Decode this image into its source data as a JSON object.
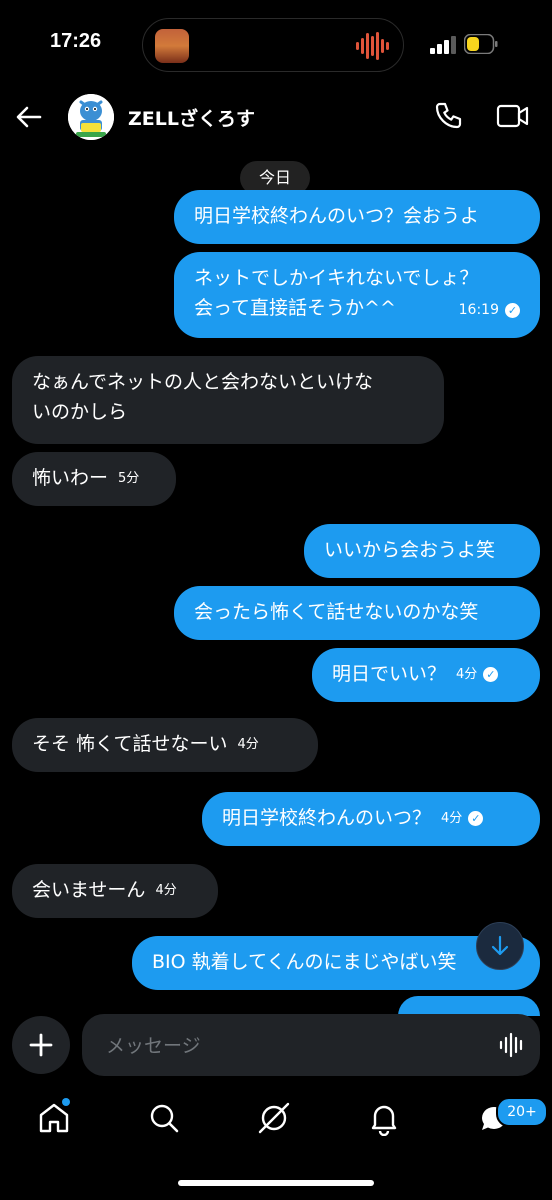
{
  "status": {
    "time": "17:26"
  },
  "header": {
    "contact_name": "ZELLざくろす"
  },
  "date_chip": "今日",
  "messages": [
    {
      "text": "明日学校終わんのいつ？会おうよ"
    },
    {
      "lines": [
        "ネットでしかイキれないでしょ？",
        "会って直接話そうか^^"
      ],
      "time": "16:19"
    },
    {
      "lines": [
        "なぁんでネットの人と会わないといけな",
        "いのかしら"
      ]
    },
    {
      "text": "怖いわー",
      "time": "5分"
    },
    {
      "text": "いいから会おうよ笑"
    },
    {
      "text": "会ったら怖くて話せないのかな笑"
    },
    {
      "text": "明日でいい？",
      "time": "4分"
    },
    {
      "text": "そそ  怖くて話せなーい",
      "time": "4分"
    },
    {
      "text": "明日学校終わんのいつ？",
      "time": "4分"
    },
    {
      "text": "会いませーん",
      "time": "4分"
    },
    {
      "text": "BIO 執着してくんのにまじやばい笑"
    }
  ],
  "composer": {
    "placeholder": "メッセージ"
  },
  "nav": {
    "badge": "20+"
  },
  "colors": {
    "accent": "#1d9bf0",
    "incoming": "#202327",
    "background": "#000000"
  }
}
